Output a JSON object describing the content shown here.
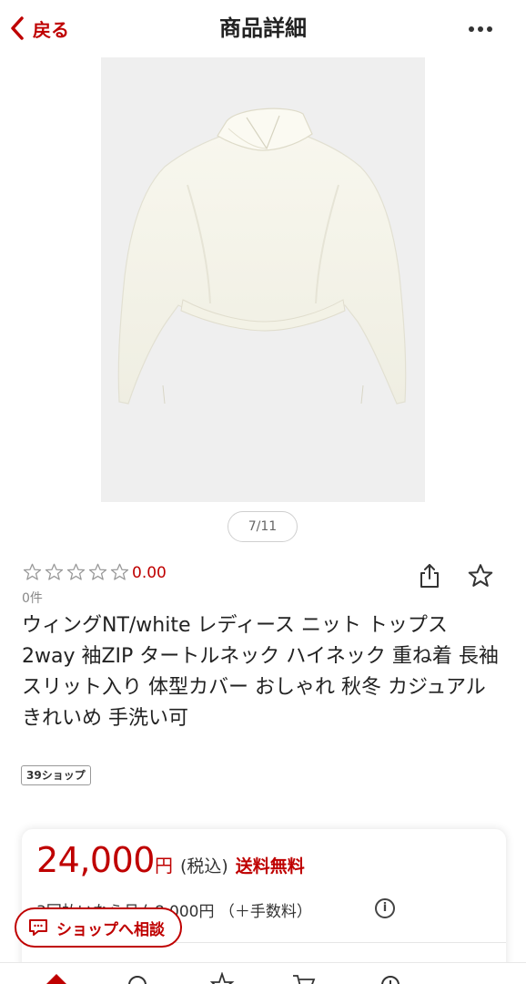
{
  "header": {
    "back_label": "戻る",
    "title": "商品詳細",
    "more_icon": "more-horizontal-icon"
  },
  "gallery": {
    "counter": "7/11"
  },
  "rating": {
    "stars": 0,
    "max_stars": 5,
    "value": "0.00",
    "review_count": "0件"
  },
  "product": {
    "name": "ウィングNT/white レディース ニット トップス 2way 袖ZIP タートルネック ハイネック 重ね着 長袖 スリット入り 体型カバー おしゃれ 秋冬 カジュアル きれいめ 手洗い可",
    "shop_badge": "39ショップ"
  },
  "price": {
    "amount": "24,000",
    "currency": "円",
    "tax": "(税込)",
    "shipping": "送料無料",
    "installment": "3回払いなら月々8,000円 （＋手数料）"
  },
  "chat": {
    "label": "ショップへ相談"
  },
  "colors": {
    "accent": "#bf0000",
    "text": "#222222",
    "muted": "#888888"
  }
}
